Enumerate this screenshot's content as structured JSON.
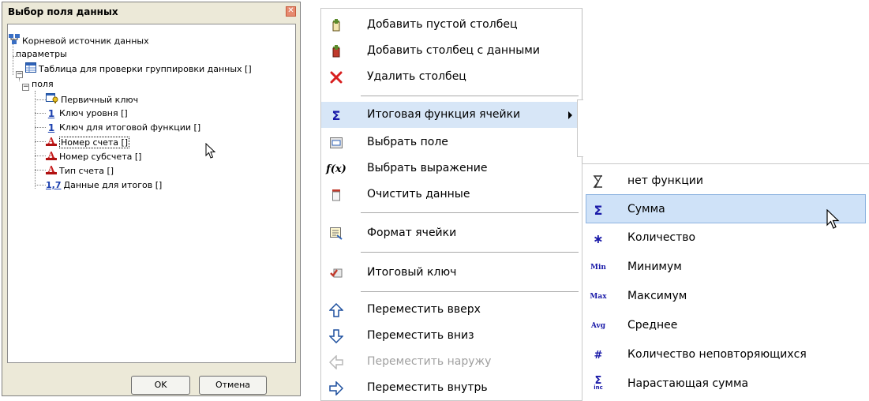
{
  "dialog": {
    "title": "Выбор поля данных",
    "close_glyph": "✕",
    "ok_label": "OK",
    "cancel_label": "Отмена",
    "tree": [
      {
        "label": "Корневой источник данных",
        "icon": "datasource-icon"
      },
      {
        "label": "параметры",
        "icon": ""
      },
      {
        "label": "Таблица для проверки группировки данных []",
        "icon": "table-icon"
      },
      {
        "label": "поля",
        "icon": ""
      },
      {
        "label": "Первичный ключ",
        "icon": "primary-key-icon"
      },
      {
        "label": "Ключ уровня []",
        "icon": "number-icon",
        "icon_text": "1"
      },
      {
        "label": "Ключ для итоговой функции []",
        "icon": "number-icon",
        "icon_text": "1"
      },
      {
        "label": "Номер счета []",
        "icon": "string-field-icon",
        "selected": true
      },
      {
        "label": "Номер субсчета []",
        "icon": "string-field-icon"
      },
      {
        "label": "Тип счета []",
        "icon": "string-field-icon"
      },
      {
        "label": "Данные для итогов []",
        "icon": "decimal-icon",
        "icon_text": "1,7"
      }
    ]
  },
  "context_menu": {
    "items": [
      {
        "label": "Добавить пустой столбец",
        "icon": "add-empty-column-icon"
      },
      {
        "label": "Добавить столбец с данными",
        "icon": "add-data-column-icon"
      },
      {
        "label": "Удалить столбец",
        "icon": "delete-icon"
      },
      {
        "label": "Итоговая функция ячейки",
        "icon": "sigma-icon",
        "submenu": true
      },
      {
        "label": "Выбрать поле",
        "icon": "select-field-icon"
      },
      {
        "label": "Выбрать выражение",
        "icon": "expression-icon"
      },
      {
        "label": "Очистить данные",
        "icon": "clear-data-icon"
      },
      {
        "label": "Формат ячейки",
        "icon": "cell-format-icon"
      },
      {
        "label": "Итоговый ключ",
        "icon": "total-key-icon"
      },
      {
        "label": "Переместить вверх",
        "icon": "arrow-up-icon"
      },
      {
        "label": "Переместить вниз",
        "icon": "arrow-down-icon"
      },
      {
        "label": "Переместить наружу",
        "icon": "arrow-left-icon",
        "disabled": true
      },
      {
        "label": "Переместить внутрь",
        "icon": "arrow-right-icon"
      }
    ]
  },
  "submenu": {
    "items": [
      {
        "label": "нет функции",
        "icon": "no-function-icon",
        "icon_text": "∑̸"
      },
      {
        "label": "Сумма",
        "icon": "sum-icon",
        "icon_text": "Σ"
      },
      {
        "label": "Количество",
        "icon": "count-icon",
        "icon_text": "∗"
      },
      {
        "label": "Минимум",
        "icon": "min-icon",
        "icon_text": "Min"
      },
      {
        "label": "Максимум",
        "icon": "max-icon",
        "icon_text": "Max"
      },
      {
        "label": "Среднее",
        "icon": "avg-icon",
        "icon_text": "Avg"
      },
      {
        "label": "Количество неповторяющихся",
        "icon": "distinct-count-icon",
        "icon_text": "#"
      },
      {
        "label": "Нарастающая сумма",
        "icon": "running-sum-icon",
        "icon_text": "Σ"
      }
    ]
  },
  "colors": {
    "menu_highlight": "#d7e6f7",
    "submenu_highlight": "#cfe2f8",
    "dialog_bg": "#ece9d8"
  }
}
